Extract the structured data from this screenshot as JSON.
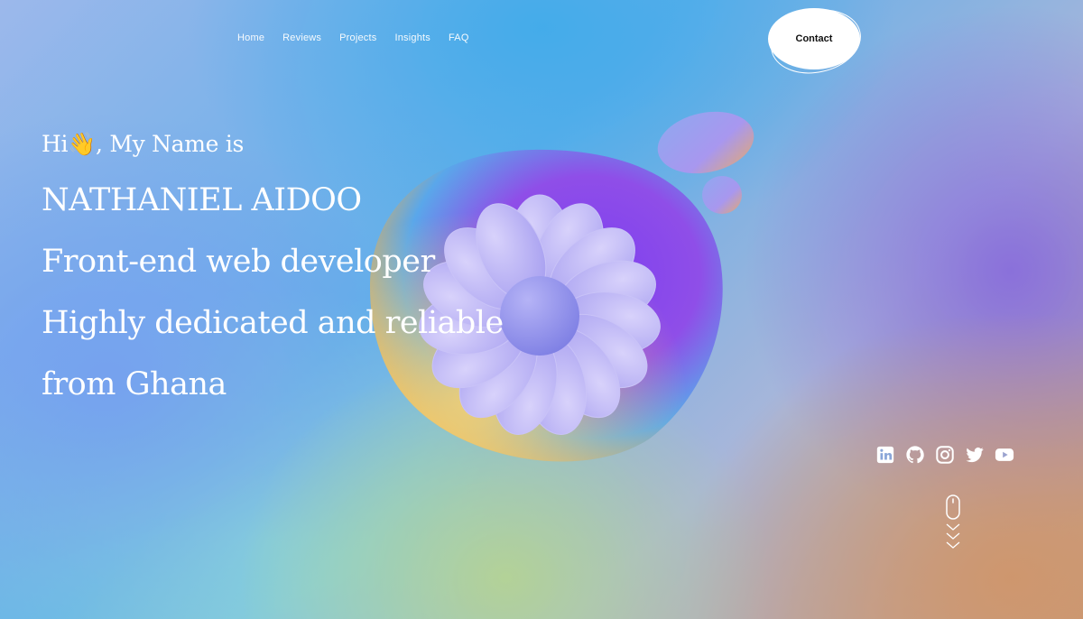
{
  "nav": {
    "items": [
      "Home",
      "Reviews",
      "Projects",
      "Insights",
      "FAQ"
    ],
    "contact": "Contact"
  },
  "hero": {
    "greeting": "Hi👋, My Name is",
    "name": "NATHANIEL AIDOO",
    "role": "Front-end web developer",
    "tagline": "Highly dedicated and reliable",
    "origin": "from Ghana"
  },
  "social": {
    "icons": [
      "linkedin-icon",
      "github-icon",
      "instagram-icon",
      "twitter-icon",
      "youtube-icon"
    ]
  },
  "colors": {
    "text": "#ffffff",
    "blob_purple": "#8a3fe6",
    "flower": "#b9b2f2"
  }
}
